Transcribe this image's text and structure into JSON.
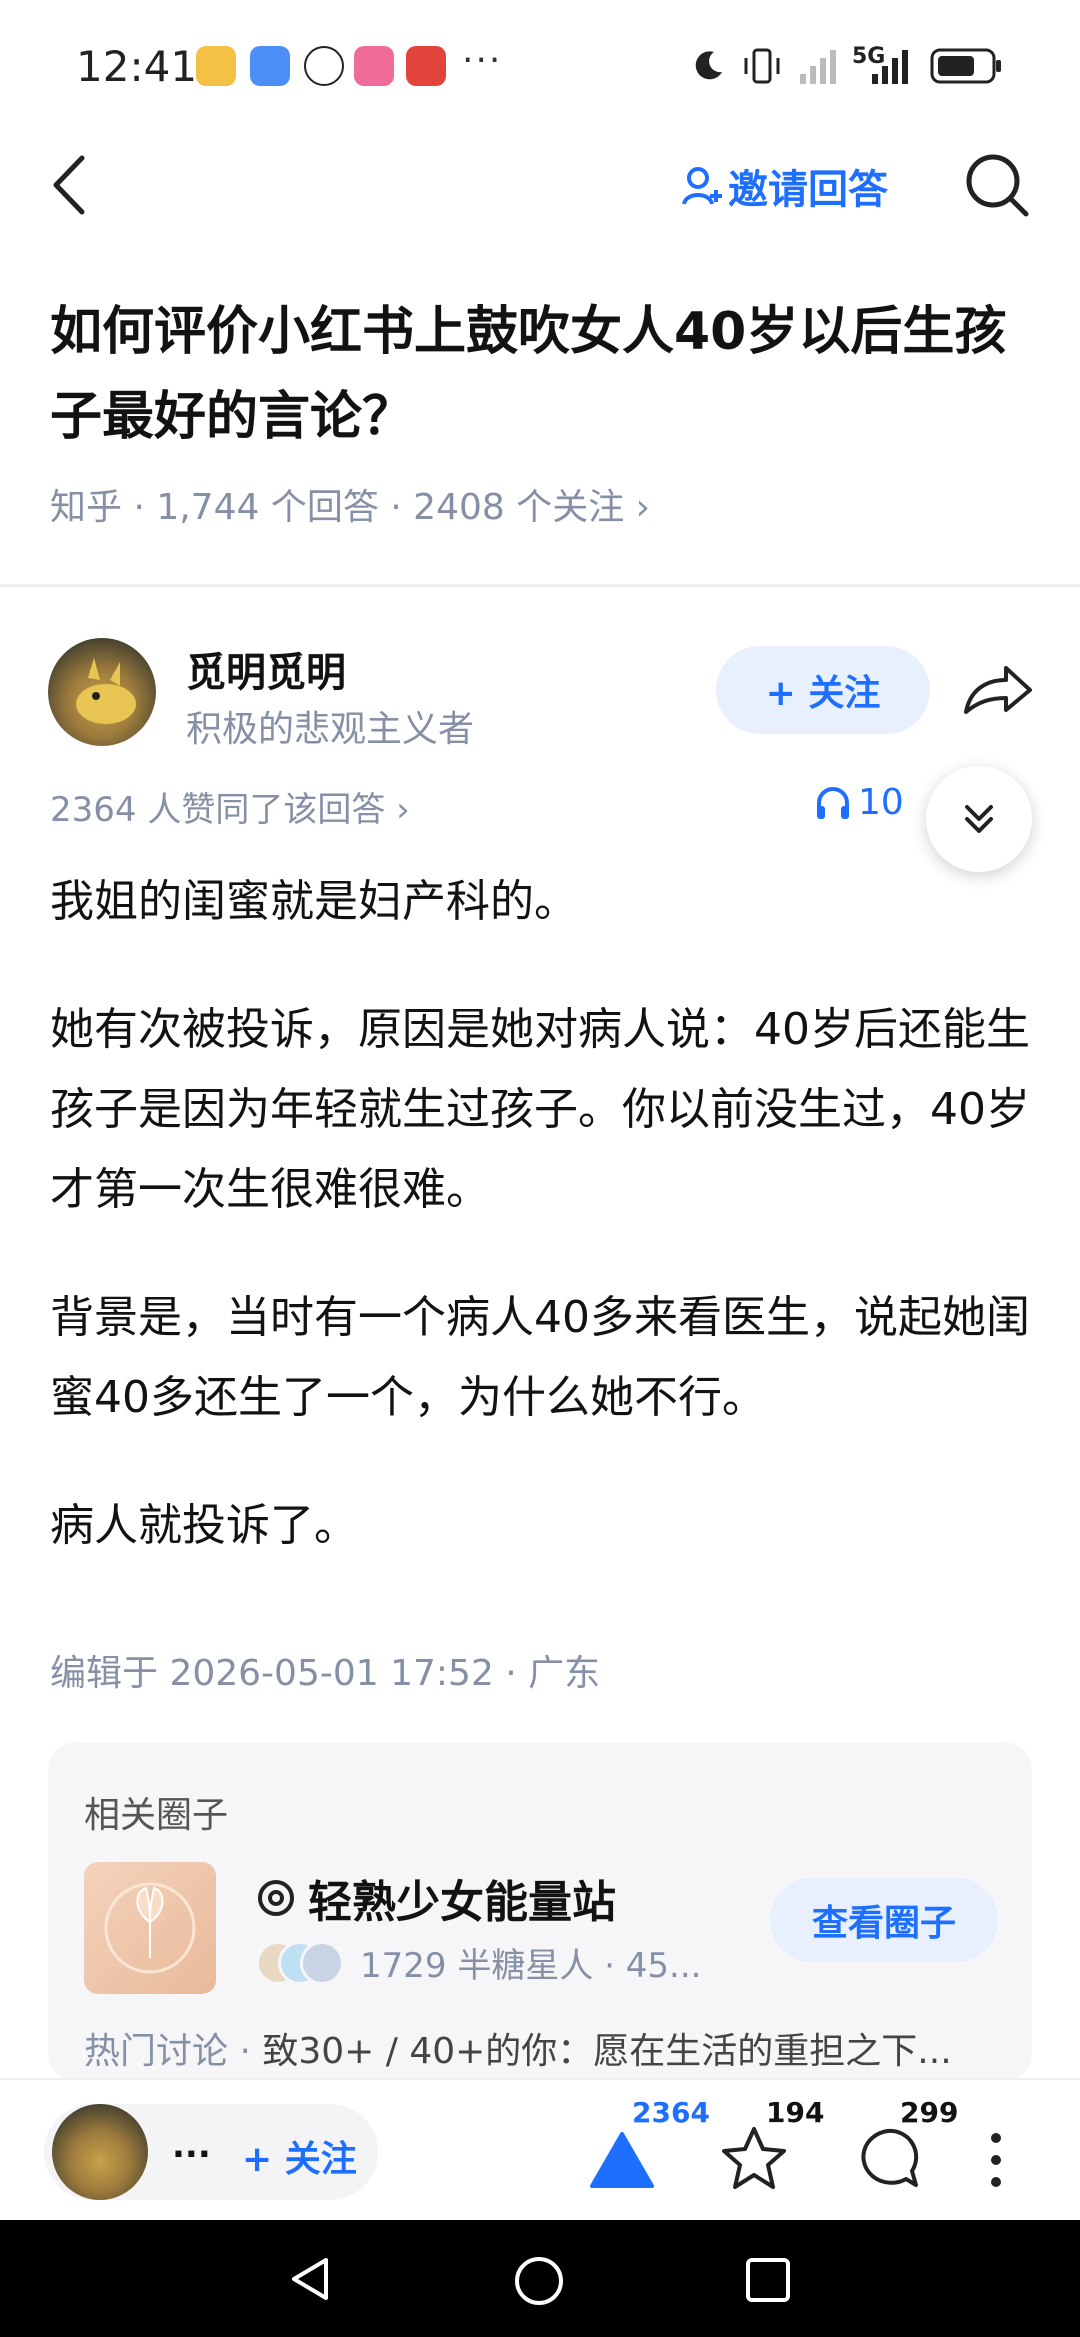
{
  "status_bar": {
    "time": "12:41",
    "more": "···",
    "network": "5G",
    "app_icons": [
      "weibo-icon",
      "message-icon",
      "qq-icon",
      "bilibili-icon",
      "alipay-icon"
    ]
  },
  "nav": {
    "invite_label": "邀请回答"
  },
  "question": {
    "title": "如何评价小红书上鼓吹女人40岁以后生孩子最好的言论？",
    "meta": "知乎 · 1,744 个回答 · 2408 个关注 ›"
  },
  "answer": {
    "author_name": "觅明觅明",
    "author_bio": "积极的悲观主义者",
    "follow_label": "+ 关注",
    "likes_text": "2364 人赞同了该回答 ›",
    "listen_text": "10",
    "paragraphs": [
      "我姐的闺蜜就是妇产科的。",
      "她有次被投诉，原因是她对病人说：40岁后还能生孩子是因为年轻就生过孩子。你以前没生过，40岁才第一次生很难很难。",
      "背景是，当时有一个病人40多来看医生，说起她闺蜜40多还生了一个，为什么她不行。",
      "病人就投诉了。"
    ],
    "edited": "编辑于 2026-05-01 17:52 · 广东"
  },
  "circle": {
    "header": "相关圈子",
    "name": "轻熟少女能量站",
    "members": "1729 半糖星人 · 45...",
    "button": "查看圈子",
    "hot_label": "热门讨论 · ",
    "hot_text": "致30+ / 40+的你：愿在生活的重担之下..."
  },
  "bottom_bar": {
    "author_short": "...",
    "follow_label": "+ 关注",
    "upvotes": "2364",
    "favorites": "194",
    "comments": "299"
  },
  "colors": {
    "accent": "#1e6fff",
    "muted": "#8590a6",
    "text": "#121212"
  }
}
